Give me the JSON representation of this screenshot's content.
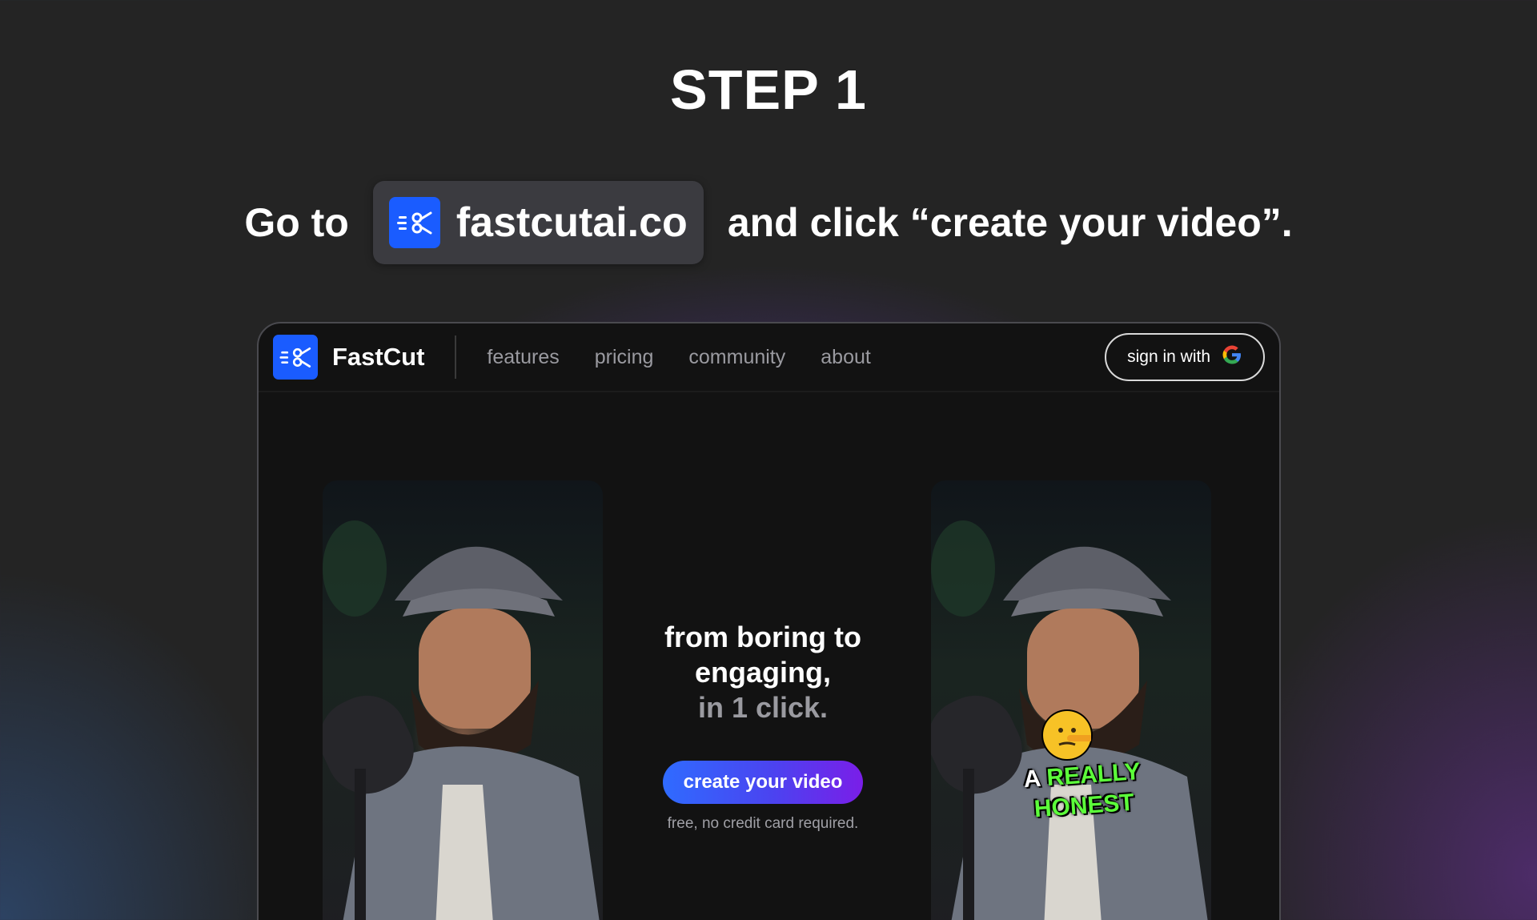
{
  "step": {
    "title": "STEP 1"
  },
  "instruction": {
    "prefix": "Go to",
    "url": "fastcutai.co",
    "suffix": "and click “create your video”."
  },
  "site": {
    "brand": "FastCut",
    "nav": [
      "features",
      "pricing",
      "community",
      "about"
    ],
    "signin_label": "sign in with",
    "hero": {
      "line1": "from boring to",
      "line2": "engaging,",
      "line3": "in 1 click.",
      "cta": "create your video",
      "note": "free, no credit card required."
    },
    "caption": {
      "word1": "A",
      "word2": "REALLY",
      "word3": "HONEST"
    }
  },
  "colors": {
    "brand_blue": "#1a5cff",
    "caption_green": "#5cff3a",
    "background": "#242424"
  }
}
